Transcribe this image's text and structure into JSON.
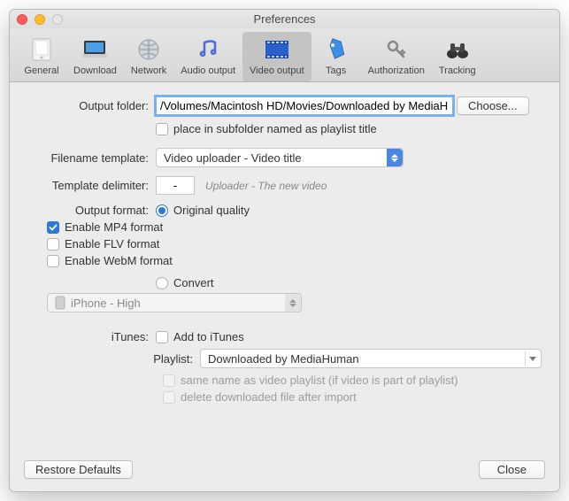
{
  "window": {
    "title": "Preferences"
  },
  "toolbar": {
    "items": [
      {
        "label": "General"
      },
      {
        "label": "Download"
      },
      {
        "label": "Network"
      },
      {
        "label": "Audio output"
      },
      {
        "label": "Video output"
      },
      {
        "label": "Tags"
      },
      {
        "label": "Authorization"
      },
      {
        "label": "Tracking"
      }
    ],
    "selected_index": 4
  },
  "labels": {
    "output_folder": "Output folder:",
    "filename_template": "Filename template:",
    "template_delimiter": "Template delimiter:",
    "output_format": "Output format:",
    "itunes": "iTunes:",
    "playlist": "Playlist:"
  },
  "output_folder": {
    "path": "/Volumes/Macintosh HD/Movies/Downloaded by MediaHuman",
    "choose": "Choose...",
    "subfolder_label": "place in subfolder named as playlist title",
    "subfolder_checked": false
  },
  "filename_template": {
    "value": "Video uploader - Video title"
  },
  "delimiter": {
    "value": "-",
    "hint": "Uploader - The new video"
  },
  "output_format": {
    "original_label": "Original quality",
    "enable_mp4": "Enable MP4 format",
    "enable_flv": "Enable FLV format",
    "enable_webm": "Enable WebM format",
    "mp4_checked": true,
    "flv_checked": false,
    "webm_checked": false,
    "convert_label": "Convert",
    "convert_preset": "iPhone - High"
  },
  "itunes": {
    "add_label": "Add to iTunes",
    "add_checked": false,
    "playlist_name": "Downloaded by MediaHuman",
    "same_name": "same name as video playlist (if video is part of playlist)",
    "delete_after": "delete downloaded file after import"
  },
  "footer": {
    "restore": "Restore Defaults",
    "close": "Close"
  }
}
